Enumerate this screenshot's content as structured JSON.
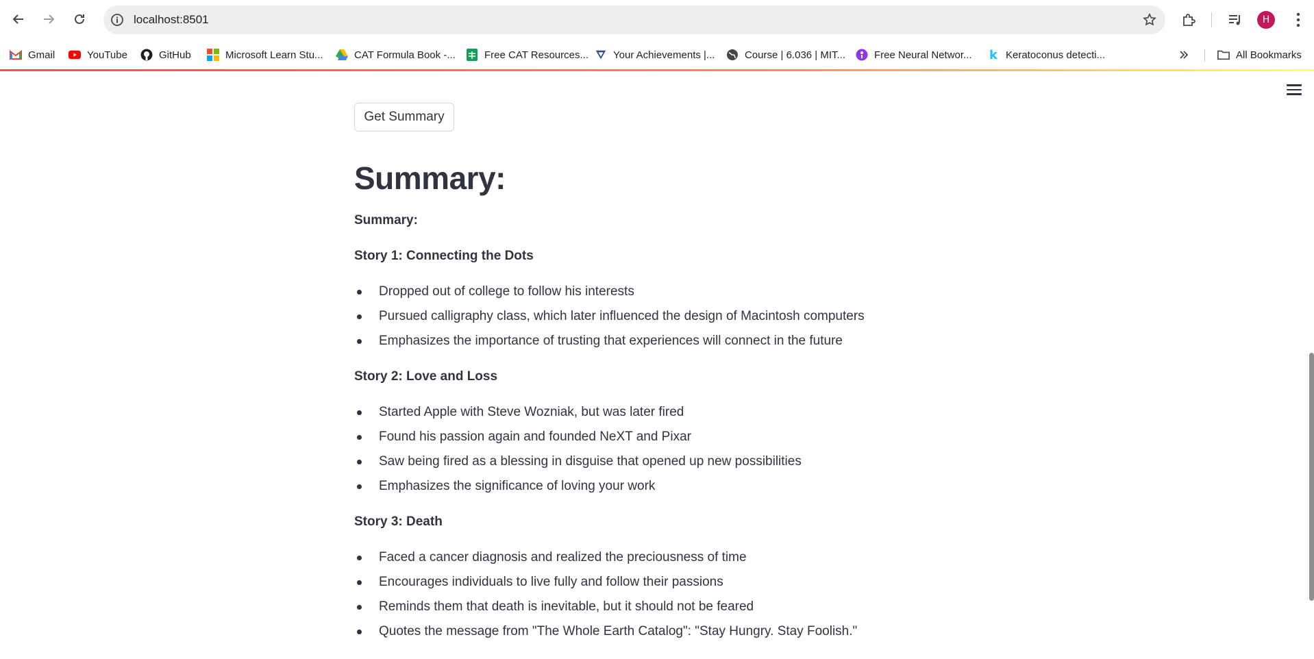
{
  "browser": {
    "url": "localhost:8501",
    "profile_initial": "H",
    "bookmarks": [
      {
        "label": "Gmail",
        "icon": "gmail-icon"
      },
      {
        "label": "YouTube",
        "icon": "youtube-icon"
      },
      {
        "label": "GitHub",
        "icon": "github-icon"
      },
      {
        "label": "Microsoft Learn Stu...",
        "icon": "microsoft-icon"
      },
      {
        "label": "CAT Formula Book -...",
        "icon": "drive-icon"
      },
      {
        "label": "Free CAT Resources...",
        "icon": "sheets-icon"
      },
      {
        "label": "Your Achievements |...",
        "icon": "achievement-icon"
      },
      {
        "label": "Course | 6.036 | MIT...",
        "icon": "globe-icon"
      },
      {
        "label": "Free Neural Networ...",
        "icon": "neural-icon"
      },
      {
        "label": "Keratoconus detecti...",
        "icon": "kaggle-icon"
      }
    ],
    "all_bookmarks_label": "All Bookmarks"
  },
  "app": {
    "button_label": "Get Summary",
    "heading": "Summary:",
    "summary_label": "Summary:",
    "stories": [
      {
        "title": "Story 1: Connecting the Dots",
        "bullets": [
          "Dropped out of college to follow his interests",
          "Pursued calligraphy class, which later influenced the design of Macintosh computers",
          "Emphasizes the importance of trusting that experiences will connect in the future"
        ]
      },
      {
        "title": "Story 2: Love and Loss",
        "bullets": [
          "Started Apple with Steve Wozniak, but was later fired",
          "Found his passion again and founded NeXT and Pixar",
          "Saw being fired as a blessing in disguise that opened up new possibilities",
          "Emphasizes the significance of loving your work"
        ]
      },
      {
        "title": "Story 3: Death",
        "bullets": [
          "Faced a cancer diagnosis and realized the preciousness of time",
          "Encourages individuals to live fully and follow their passions",
          "Reminds them that death is inevitable, but it should not be feared",
          "Quotes the message from \"The Whole Earth Catalog\": \"Stay Hungry. Stay Foolish.\""
        ]
      }
    ]
  },
  "colors": {
    "text": "#31333f",
    "accent_gradient_start": "#ff4b4b",
    "accent_gradient_end": "#fffd80",
    "avatar": "#c2185b"
  }
}
